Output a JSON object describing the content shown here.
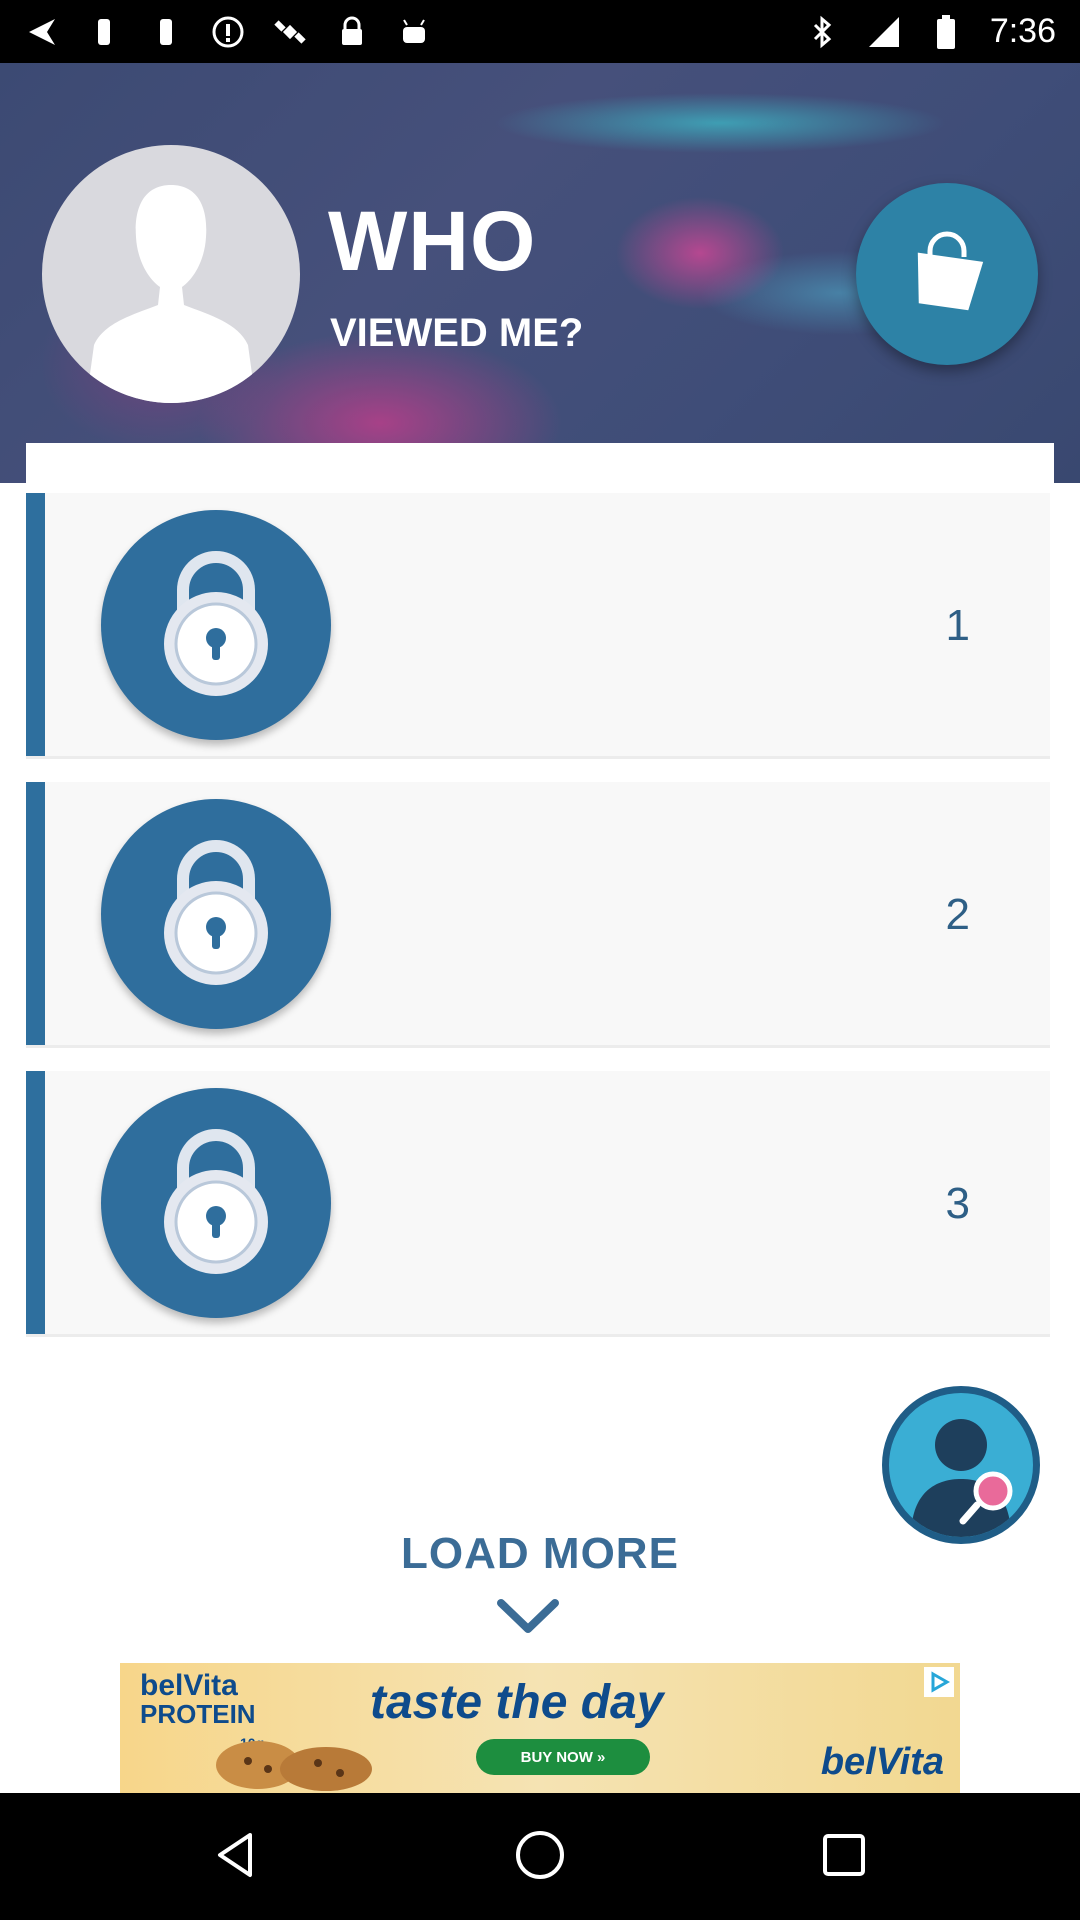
{
  "status_bar": {
    "time": "7:36",
    "icons": [
      "navigation-icon",
      "notification-icon",
      "notification-icon",
      "info-icon",
      "satellite-icon",
      "lock-icon",
      "android-icon",
      "bluetooth-icon",
      "signal-icon",
      "battery-icon"
    ]
  },
  "header": {
    "title": "WHO",
    "subtitle": "VIEWED ME?",
    "avatar_icon": "default-profile-silhouette-icon",
    "shop_icon": "shopping-bag-icon"
  },
  "visitors": [
    {
      "rank": "1",
      "icon": "lock-icon"
    },
    {
      "rank": "2",
      "icon": "lock-icon"
    },
    {
      "rank": "3",
      "icon": "lock-icon"
    }
  ],
  "search_button_icon": "person-search-icon",
  "load_more": {
    "label": "LOAD MORE",
    "icon": "chevron-down-icon"
  },
  "ad": {
    "brand_line1": "belVita",
    "brand_line2": "PROTEIN",
    "brand_detail": "10g",
    "tagline": "taste the day",
    "cta": "BUY NOW »",
    "brand_footer": "belVita"
  },
  "colors": {
    "accent_blue": "#2e6f9e",
    "number_blue": "#2e5f86",
    "load_more_blue": "#3b6c96",
    "hero_bg": "#3f4d78",
    "fab_cyan": "#3aaed4"
  },
  "nav_bar": {
    "buttons": [
      "back-icon",
      "home-icon",
      "recents-icon"
    ]
  }
}
